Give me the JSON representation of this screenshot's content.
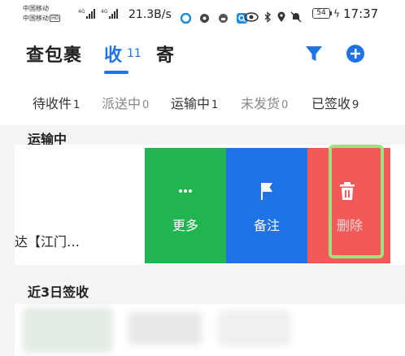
{
  "status_bar": {
    "carrier1": "中国移动",
    "carrier2": "中国移动",
    "hd": "HD",
    "net1": "4G",
    "net2": "4G",
    "speed": "21.3B/s",
    "battery": "54",
    "time": "17:37"
  },
  "header": {
    "app_title": "查包裹",
    "tab_receive_label": "收",
    "tab_receive_count": "11",
    "tab_send_label": "寄",
    "accent_color": "#1f73e6"
  },
  "filters": [
    {
      "label": "待收件",
      "count": "1"
    },
    {
      "label": "派送中",
      "count": "0"
    },
    {
      "label": "运输中",
      "count": "1"
    },
    {
      "label": "未发货",
      "count": "0"
    },
    {
      "label": "已签收",
      "count": "9"
    }
  ],
  "sections": {
    "in_transit": "运输中",
    "recent_signed": "近3日签收"
  },
  "card": {
    "partial_text": "达【江门…"
  },
  "swipe_actions": [
    {
      "label": "更多",
      "icon": "more-dots-icon",
      "color": "#21b451"
    },
    {
      "label": "备注",
      "icon": "flag-icon",
      "color": "#1f73e6"
    },
    {
      "label": "删除",
      "icon": "trash-icon",
      "color": "#f25a5a"
    }
  ]
}
